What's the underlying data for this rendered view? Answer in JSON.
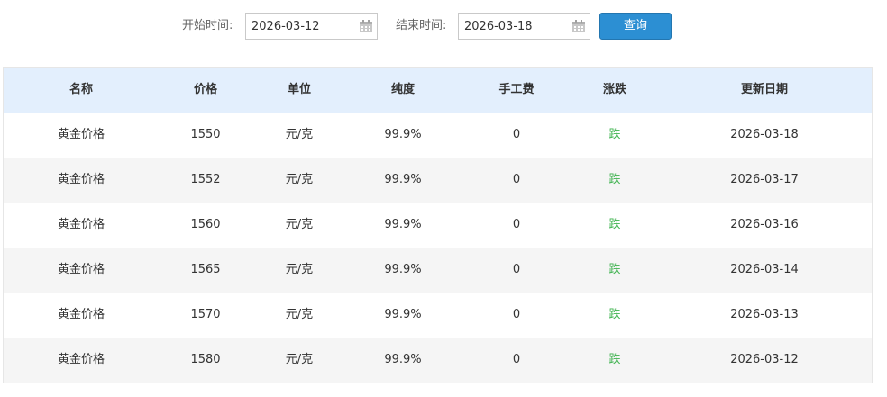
{
  "filter": {
    "start_label": "开始时间:",
    "start_value": "2026-03-12",
    "end_label": "结束时间:",
    "end_value": "2026-03-18",
    "query_label": "查询",
    "calendar_icon": "calendar-icon"
  },
  "table": {
    "headers": [
      "名称",
      "价格",
      "单位",
      "纯度",
      "手工费",
      "涨跌",
      "更新日期"
    ],
    "rows": [
      [
        "黄金价格",
        "1550",
        "元/克",
        "99.9%",
        "0",
        "跌",
        "2026-03-18"
      ],
      [
        "黄金价格",
        "1552",
        "元/克",
        "99.9%",
        "0",
        "跌",
        "2026-03-17"
      ],
      [
        "黄金价格",
        "1560",
        "元/克",
        "99.9%",
        "0",
        "跌",
        "2026-03-16"
      ],
      [
        "黄金价格",
        "1565",
        "元/克",
        "99.9%",
        "0",
        "跌",
        "2026-03-14"
      ],
      [
        "黄金价格",
        "1570",
        "元/克",
        "99.9%",
        "0",
        "跌",
        "2026-03-13"
      ],
      [
        "黄金价格",
        "1580",
        "元/克",
        "99.9%",
        "0",
        "跌",
        "2026-03-12"
      ]
    ]
  },
  "colors": {
    "header_bg": "#e3effd",
    "alt_row_bg": "#f5f5f5",
    "button_bg": "#2c8fd3",
    "trend_down": "#3fb34f"
  }
}
